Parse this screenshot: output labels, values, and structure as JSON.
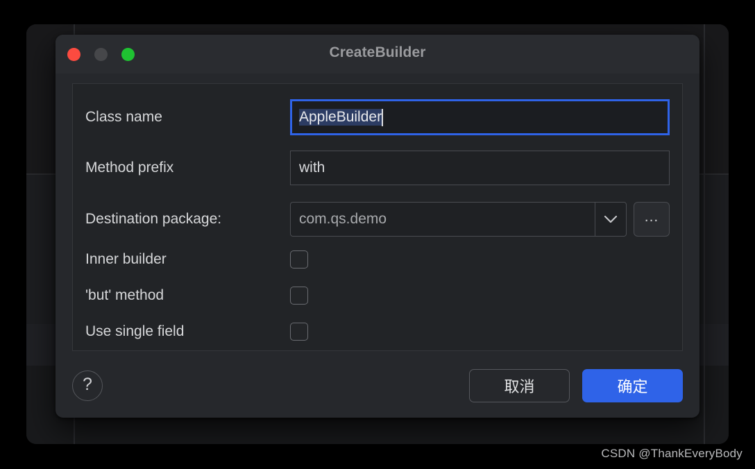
{
  "window": {
    "title": "CreateBuilder",
    "traffic_lights": [
      {
        "name": "close",
        "color": "#fc4b40"
      },
      {
        "name": "minimize",
        "color": "#46474a"
      },
      {
        "name": "zoom",
        "color": "#1fc232"
      }
    ]
  },
  "form": {
    "class_name": {
      "label": "Class name",
      "value": "AppleBuilder",
      "selected": true,
      "focused": true
    },
    "method_prefix": {
      "label": "Method prefix",
      "value": "with"
    },
    "destination_package": {
      "label": "Destination package:",
      "value": "com.qs.demo",
      "dropdown_icon": "chevron-down-icon",
      "browse_label": "..."
    },
    "checkboxes": [
      {
        "label": "Inner builder",
        "checked": false
      },
      {
        "label": "'but' method",
        "checked": false
      },
      {
        "label": "Use single field",
        "checked": false
      }
    ]
  },
  "footer": {
    "help_label": "?",
    "cancel_label": "取消",
    "ok_label": "确定",
    "ok_color": "#2f63e8"
  },
  "watermark": {
    "text": "CSDN @ThankEveryBody"
  }
}
